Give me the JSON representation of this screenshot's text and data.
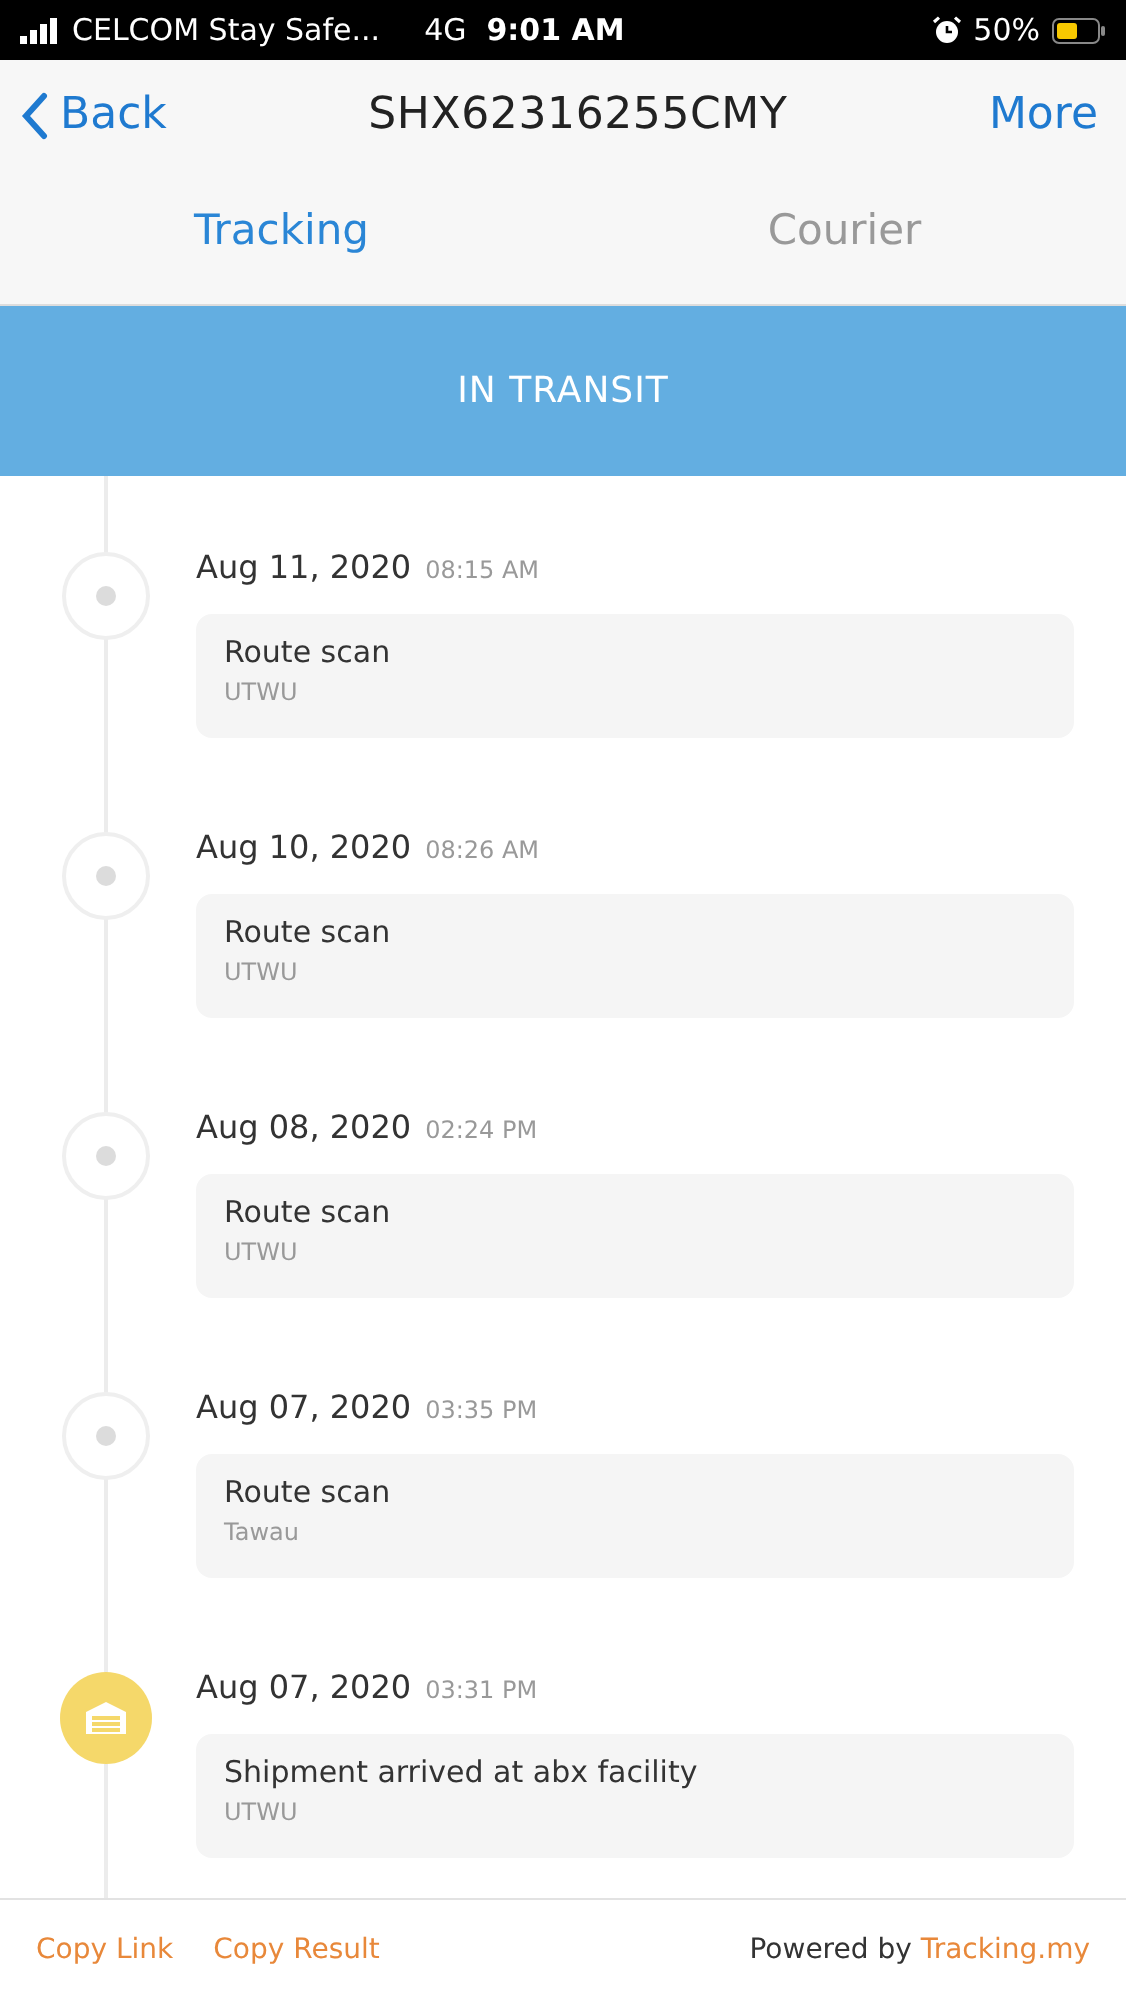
{
  "status_bar": {
    "carrier": "CELCOM Stay Safe...",
    "network": "4G",
    "time": "9:01 AM",
    "battery": "50%"
  },
  "nav": {
    "back": "Back",
    "title": "SHX62316255CMY",
    "more": "More"
  },
  "tabs": [
    {
      "label": "Tracking",
      "selected": true
    },
    {
      "label": "Courier",
      "selected": false
    }
  ],
  "banner": "IN TRANSIT",
  "events": [
    {
      "kind": "scan",
      "date": "Aug 11, 2020",
      "time": "08:15 AM",
      "title": "Route scan",
      "location": "UTWU"
    },
    {
      "kind": "scan",
      "date": "Aug 10, 2020",
      "time": "08:26 AM",
      "title": "Route scan",
      "location": "UTWU"
    },
    {
      "kind": "scan",
      "date": "Aug 08, 2020",
      "time": "02:24 PM",
      "title": "Route scan",
      "location": "UTWU"
    },
    {
      "kind": "scan",
      "date": "Aug 07, 2020",
      "time": "03:35 PM",
      "title": "Route scan",
      "location": "Tawau"
    },
    {
      "kind": "facility",
      "date": "Aug 07, 2020",
      "time": "03:31 PM",
      "title": "Shipment arrived at abx facility",
      "location": "UTWU"
    }
  ],
  "footer": {
    "links": [
      "Copy Link",
      "Copy Result"
    ],
    "powered_by": "Powered by",
    "brand": "Tracking.my"
  }
}
